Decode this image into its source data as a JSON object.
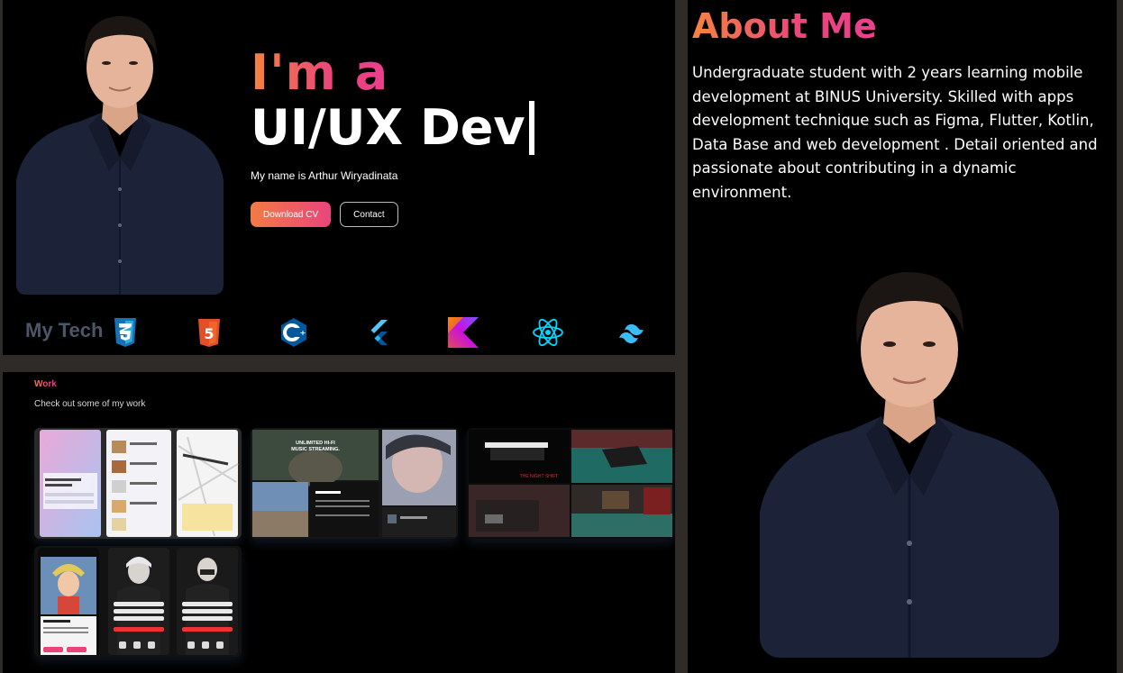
{
  "hero": {
    "headline_prefix": "I'm a",
    "headline_role": "UI/UX Dev",
    "name_line": "My name is Arthur Wiryadinata",
    "download_button": "Download CV",
    "contact_button": "Contact",
    "portrait_icon": "person-portrait"
  },
  "tech": {
    "title": "My Tech",
    "icons": [
      "css3-icon",
      "html5-icon",
      "cplusplus-icon",
      "flutter-icon",
      "kotlin-icon",
      "react-icon",
      "tailwind-icon"
    ]
  },
  "work": {
    "label": "Work",
    "subtitle": "Check out some of my work",
    "cards": [
      {
        "icon": "pet-app-mockup"
      },
      {
        "icon": "music-app-mockup",
        "caption": "UNLIMITED HI-FI MUSIC STREAMING."
      },
      {
        "icon": "horror-game-screens"
      },
      {
        "icon": "mobile-app-mockup"
      }
    ]
  },
  "about": {
    "title": "About Me",
    "body": "Undergraduate student with 2 years learning mobile development at BINUS University. Skilled with apps development technique such as Figma, Flutter, Kotlin, Data Base and web development . Detail oriented and passionate about contributing in a dynamic environment."
  },
  "colors": {
    "accent_start": "#f5833f",
    "accent_end": "#e9457c",
    "background": "#000000",
    "frame": "#2f2b29"
  }
}
